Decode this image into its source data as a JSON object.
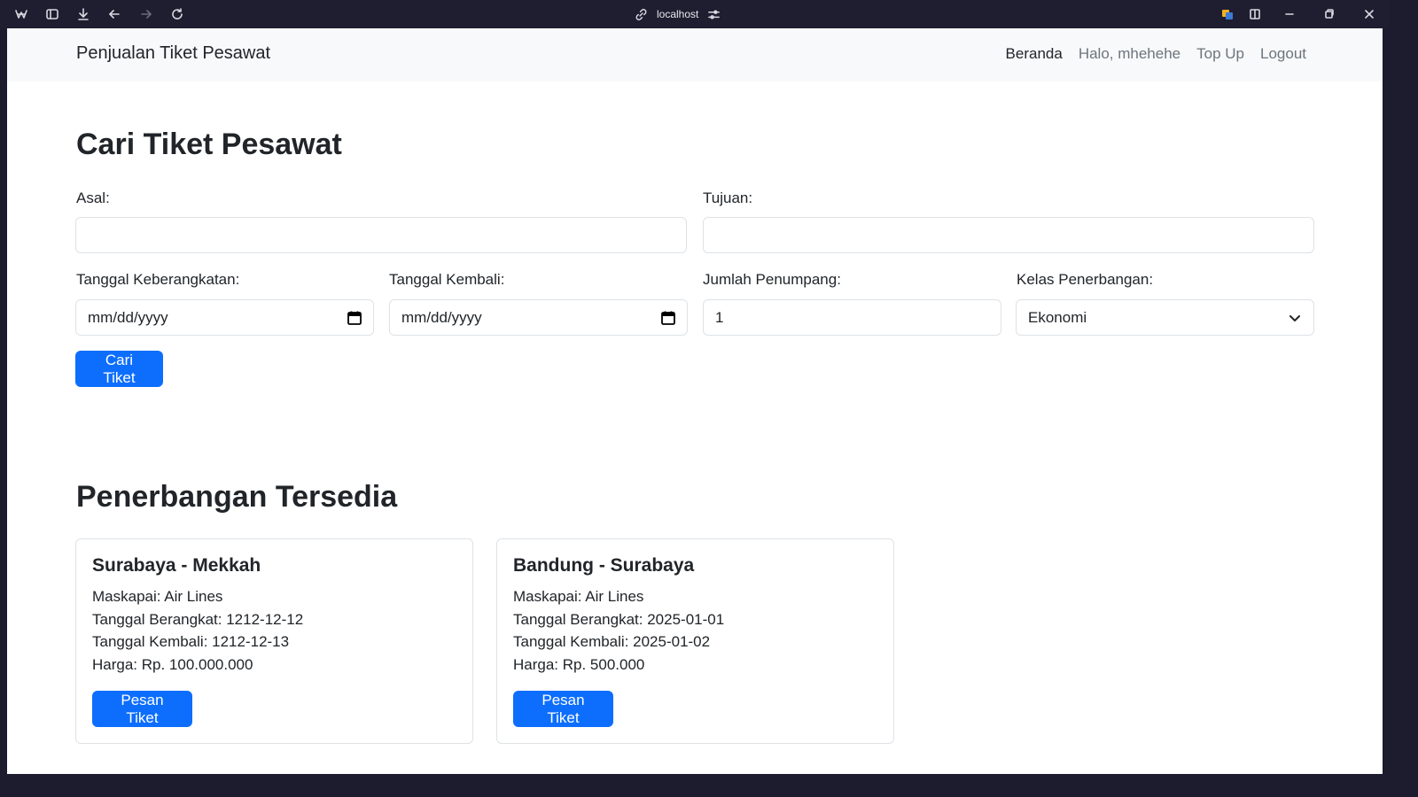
{
  "browser": {
    "url": "localhost",
    "icons": [
      "app-logo-icon",
      "sidebar-toggle-icon",
      "download-icon",
      "back-icon",
      "forward-icon",
      "reload-icon",
      "link-icon",
      "site-settings-icon",
      "extension-icon",
      "split-view-icon",
      "minimize-icon",
      "restore-icon",
      "close-icon"
    ]
  },
  "navbar": {
    "brand": "Penjualan Tiket Pesawat",
    "items": [
      {
        "label": "Beranda",
        "active": true
      },
      {
        "label": "Halo, mhehehe",
        "active": false
      },
      {
        "label": "Top Up",
        "active": false
      },
      {
        "label": "Logout",
        "active": false
      }
    ]
  },
  "search": {
    "title": "Cari Tiket Pesawat",
    "asal_label": "Asal:",
    "asal_value": "",
    "tujuan_label": "Tujuan:",
    "tujuan_value": "",
    "berangkat_label": "Tanggal Keberangkatan:",
    "berangkat_placeholder": "mm/dd/yyyy",
    "kembali_label": "Tanggal Kembali:",
    "kembali_placeholder": "mm/dd/yyyy",
    "penumpang_label": "Jumlah Penumpang:",
    "penumpang_value": "1",
    "kelas_label": "Kelas Penerbangan:",
    "kelas_value": "Ekonomi",
    "submit_label": "Cari Tiket"
  },
  "flights": {
    "title": "Penerbangan Tersedia",
    "cards": [
      {
        "route": "Surabaya - Mekkah",
        "maskapai": "Maskapai: Air Lines",
        "berangkat": "Tanggal Berangkat: 1212-12-12",
        "kembali": "Tanggal Kembali: 1212-12-13",
        "harga": "Harga: Rp. 100.000.000",
        "button": "Pesan Tiket"
      },
      {
        "route": "Bandung - Surabaya",
        "maskapai": "Maskapai: Air Lines",
        "berangkat": "Tanggal Berangkat: 2025-01-01",
        "kembali": "Tanggal Kembali: 2025-01-02",
        "harga": "Harga: Rp. 500.000",
        "button": "Pesan Tiket"
      }
    ]
  },
  "colors": {
    "primary": "#0d6efd",
    "navbar_bg": "#f8f9fa",
    "text": "#212529",
    "muted": "#6c757d",
    "chrome_bg": "#1f1d30"
  }
}
